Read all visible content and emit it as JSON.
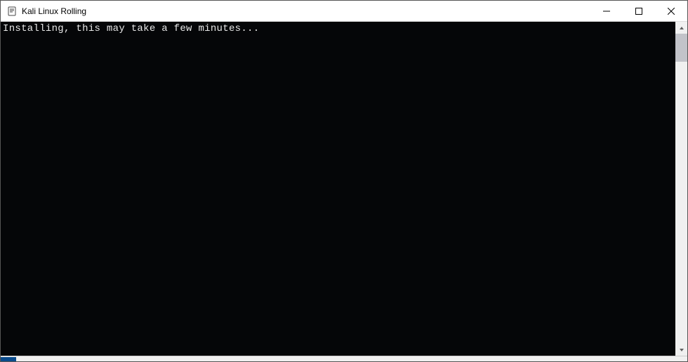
{
  "window": {
    "title": "Kali Linux Rolling"
  },
  "terminal": {
    "line1": "Installing, this may take a few minutes..."
  }
}
